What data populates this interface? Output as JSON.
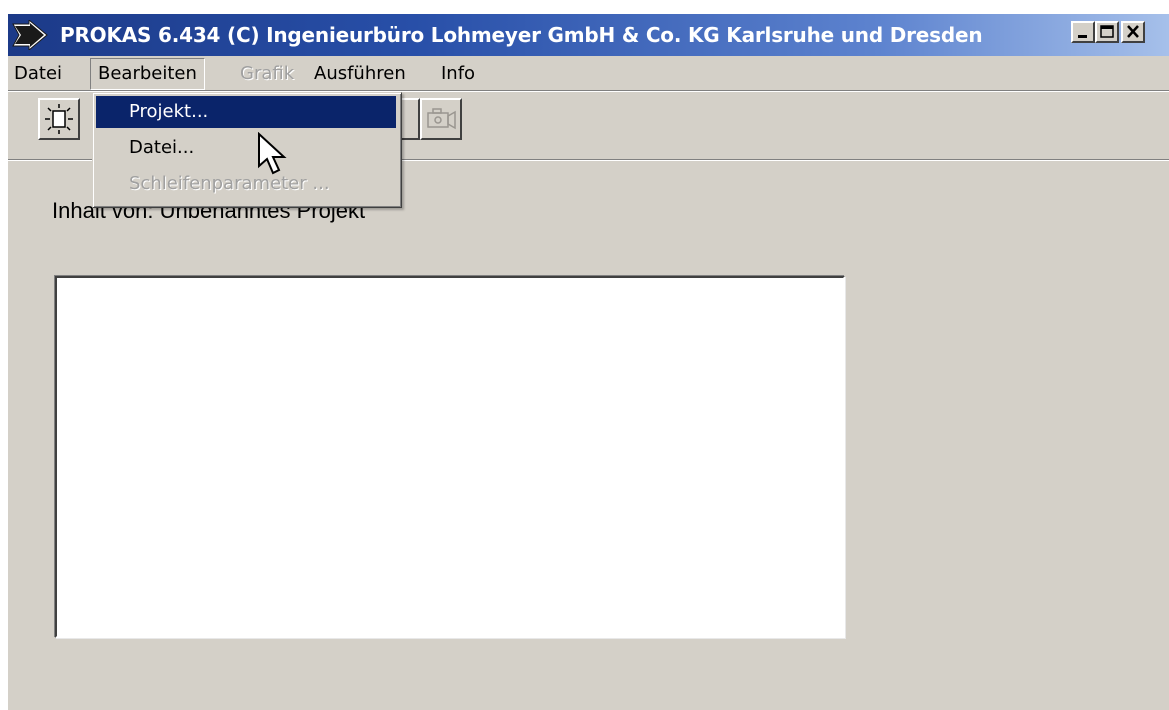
{
  "window": {
    "title": "PROKAS 6.434   (C) Ingenieurbüro Lohmeyer GmbH & Co. KG Karlsruhe und Dresden",
    "controls": [
      "minimize-icon",
      "maximize-icon",
      "close-icon"
    ]
  },
  "menubar": {
    "items": [
      {
        "label": "Datei",
        "enabled": true,
        "open": false
      },
      {
        "label": "Bearbeiten",
        "enabled": true,
        "open": true
      },
      {
        "label": "Grafik",
        "enabled": false,
        "open": false
      },
      {
        "label": "Ausführen",
        "enabled": true,
        "open": false
      },
      {
        "label": "Info",
        "enabled": true,
        "open": false
      }
    ]
  },
  "dropdown": {
    "items": [
      {
        "label": "Projekt...",
        "enabled": true,
        "highlighted": true
      },
      {
        "label": "Datei...",
        "enabled": true,
        "highlighted": false
      },
      {
        "label": "Schleifenparameter ...",
        "enabled": false,
        "highlighted": false
      }
    ]
  },
  "toolbar": {
    "buttons": [
      "new-project-icon",
      "hidden-button",
      "hidden-button",
      "open-document-icon",
      "camera-icon"
    ]
  },
  "content": {
    "label": "Inhalt von: Unbenanntes Projekt"
  },
  "colors": {
    "face": "#d4d0c8",
    "highlight": "#0a246a",
    "title_start": "#1c3a88",
    "title_end": "#a6c0ea"
  }
}
